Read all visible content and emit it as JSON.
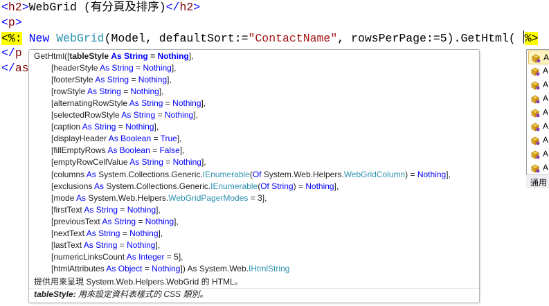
{
  "editor": {
    "line1": {
      "open_lt": "<",
      "open_name": "h2",
      "open_gt": ">",
      "text": "WebGrid (有分頁及排序)",
      "close_lt": "</",
      "close_name": "h2",
      "close_gt": ">"
    },
    "line2": {
      "lt": "<",
      "name": "p",
      "gt": ">"
    },
    "line3": {
      "open_delim": "<%:",
      "kw_new": "New",
      "class_name": "WebGrid",
      "args_a": "(Model, defaultSort:=",
      "sort_value": "\"ContactName\"",
      "args_b": ", rowsPerPage:=5).GetHtml( ",
      "close_delim": "%>"
    },
    "line4": {
      "lt": "</",
      "name": "p",
      "gt": ">"
    },
    "line5": {
      "lt": "</",
      "name": "as"
    }
  },
  "tooltip": {
    "sig_head": "GetHtml([",
    "params": [
      {
        "name": "tableStyle",
        "as": "As",
        "type": "String",
        "eq": " = ",
        "default": "Nothing",
        "end": "],"
      },
      {
        "name": "headerStyle",
        "as": "As",
        "type": "String",
        "eq": " = ",
        "default": "Nothing",
        "end": "],"
      },
      {
        "name": "footerStyle",
        "as": "As",
        "type": "String",
        "eq": " = ",
        "default": "Nothing",
        "end": "],"
      },
      {
        "name": "rowStyle",
        "as": "As",
        "type": "String",
        "eq": " = ",
        "default": "Nothing",
        "end": "],"
      },
      {
        "name": "alternatingRowStyle",
        "as": "As",
        "type": "String",
        "eq": " = ",
        "default": "Nothing",
        "end": "],"
      },
      {
        "name": "selectedRowStyle",
        "as": "As",
        "type": "String",
        "eq": " = ",
        "default": "Nothing",
        "end": "],"
      },
      {
        "name": "caption",
        "as": "As",
        "type": "String",
        "eq": " = ",
        "default": "Nothing",
        "end": "],"
      },
      {
        "name": "displayHeader",
        "as": "As",
        "type": "Boolean",
        "eq": " = ",
        "default": "True",
        "end": "],"
      },
      {
        "name": "fillEmptyRows",
        "as": "As",
        "type": "Boolean",
        "eq": " = ",
        "default": "False",
        "end": "],"
      },
      {
        "name": "emptyRowCellValue",
        "as": "As",
        "type": "String",
        "eq": " = ",
        "default": "Nothing",
        "end": "],"
      }
    ],
    "columns_line": {
      "name": "columns",
      "as": "As",
      "ns": "System.Collections.Generic.",
      "generic": "IEnumerable",
      "paren_open": "(",
      "of": "Of",
      "inner_ns": "System.Web.Helpers.",
      "inner_type": "WebGridColumn",
      "tail": ") = ",
      "default": "Nothing",
      "end": "],"
    },
    "exclusions_line": {
      "name": "exclusions",
      "as": "As",
      "ns": "System.Collections.Generic.",
      "generic": "IEnumerable",
      "paren_open": "(",
      "of": "Of",
      "inner_type": "String",
      "tail": ") = ",
      "default": "Nothing",
      "end": "],"
    },
    "mode_line": {
      "name": "mode",
      "as": "As",
      "ns": "System.Web.Helpers.",
      "type": "WebGridPagerModes",
      "tail": " = 3],"
    },
    "params2": [
      {
        "name": "firstText",
        "as": "As",
        "type": "String",
        "eq": " = ",
        "default": "Nothing",
        "end": "],"
      },
      {
        "name": "previousText",
        "as": "As",
        "type": "String",
        "eq": " = ",
        "default": "Nothing",
        "end": "],"
      },
      {
        "name": "nextText",
        "as": "As",
        "type": "String",
        "eq": " = ",
        "default": "Nothing",
        "end": "],"
      },
      {
        "name": "lastText",
        "as": "As",
        "type": "String",
        "eq": " = ",
        "default": "Nothing",
        "end": "],"
      },
      {
        "name": "numericLinksCount",
        "as": "As",
        "type": "Integer",
        "eq": " = 5",
        "default": "",
        "end": "],"
      }
    ],
    "last_line": {
      "name": "htmlAttributes",
      "as": "As",
      "type": "Object",
      "eq": " = ",
      "default": "Nothing",
      "mid": "]) ",
      "ret_as": "As",
      "ret_ns": "System.Web.",
      "ret_type": "IHtmlString"
    },
    "description": "提供用來呈現 System.Web.Helpers.WebGrid 的 HTML。",
    "param_doc_name": "tableStyle:",
    "param_doc_text": " 用來設定資料表樣式的 CSS 類別。"
  },
  "completion": {
    "items": [
      "A",
      "A",
      "A",
      "A",
      "A",
      "A",
      "A",
      "A",
      "A"
    ],
    "tab_label": "通用"
  },
  "colors": {
    "keyword": "#0000ff",
    "type": "#2b91af",
    "string": "#a31515",
    "tag_name": "#800000",
    "asp_delimiter_bg": "#ffff00"
  }
}
